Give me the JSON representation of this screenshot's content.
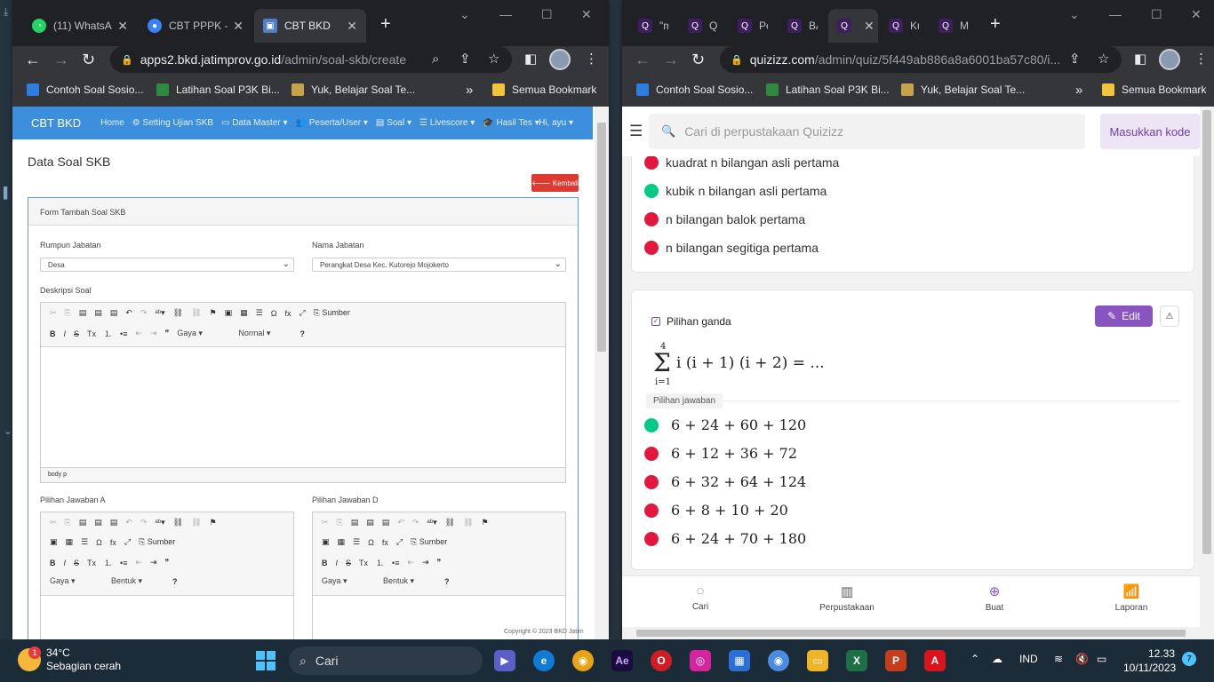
{
  "left_browser": {
    "tabs": [
      {
        "label": "(11) WhatsA",
        "icon": "whatsapp-icon",
        "color": "#25d366"
      },
      {
        "label": "CBT PPPK -",
        "icon": "user-icon",
        "color": "#3b82f6"
      },
      {
        "label": "CBT BKD",
        "icon": "jatim-logo-icon",
        "color": "#4f7ec4"
      }
    ],
    "url_host": "apps2.bkd.jatimprov.go.id",
    "url_path": "/admin/soal-skb/create",
    "bookmarks": [
      "Contoh Soal Sosio...",
      "Latihan Soal P3K Bi...",
      "Yuk, Belajar Soal Te..."
    ],
    "bookmarks_more": "»",
    "bookmarks_folder": "Semua Bookmark"
  },
  "cbt": {
    "brand": "CBT BKD",
    "menu": [
      "Home",
      "⚙ Setting Ujian SKB",
      "▭ Data Master ▾",
      "👥 Peserta/User ▾",
      "▤ Soal ▾",
      "☰ Livescore ▾",
      "🎓 Hasil Tes ▾"
    ],
    "user": "Hi, ayu ▾",
    "page_title": "Data Soal SKB",
    "back_button": "🡐 Kembali",
    "form_title": "Form Tambah Soal SKB",
    "rumpun_label": "Rumpun Jabatan",
    "rumpun_value": "Desa",
    "nama_label": "Nama Jabatan",
    "nama_value": "Perangkat Desa Kec. Kutorejo Mojokerto",
    "deskripsi_label": "Deskripsi Soal",
    "editor_source": "Sumber",
    "editor_style": "Gaya",
    "editor_format": "Normal",
    "editor_shape": "Bentuk",
    "editor_help": "?",
    "editor_path": "body   p",
    "pilihan_a_label": "Pilihan Jawaban A",
    "pilihan_d_label": "Pilihan Jawaban D",
    "copyright": "Copyright © 2023 BKD Jatim"
  },
  "right_browser": {
    "tabs": [
      "\"m",
      "Qu",
      "Per",
      "BA",
      "",
      "Kui",
      "MA"
    ],
    "url_host": "quizizz.com",
    "url_path": "/admin/quiz/5f449ab886a8a6001ba57c80/i...",
    "bookmarks": [
      "Contoh Soal Sosio...",
      "Latihan Soal P3K Bi...",
      "Yuk, Belajar Soal Te..."
    ],
    "bookmarks_more": "»",
    "bookmarks_folder": "Semua Bookmark"
  },
  "quizizz": {
    "search_placeholder": "Cari di perpustakaan Quizizz",
    "enter_code": "Masukkan kode",
    "prev_options": [
      {
        "text": "kuadrat n bilangan asli pertama",
        "correct": false
      },
      {
        "text": "kubik n bilangan asli pertama",
        "correct": true
      },
      {
        "text": "n bilangan balok pertama",
        "correct": false
      },
      {
        "text": "n bilangan segitiga pertama",
        "correct": false
      }
    ],
    "question_type": "Pilihan ganda",
    "edit_label": "Edit",
    "sum_upper": "4",
    "sum_lower": "i=1",
    "sum_expr": "i (i + 1) (i + 2) = ...",
    "answers_label": "Pilihan jawaban",
    "answers": [
      {
        "text": "6 + 24 + 60 + 120",
        "correct": true
      },
      {
        "text": "6 + 12 + 36 + 72",
        "correct": false
      },
      {
        "text": "6 + 32 + 64 + 124",
        "correct": false
      },
      {
        "text": "6 + 8 + 10 + 20",
        "correct": false
      },
      {
        "text": "6 + 24 + 70 + 180",
        "correct": false
      }
    ],
    "bottom_nav": [
      {
        "label": "Cari",
        "icon": "search-icon"
      },
      {
        "label": "Perpustakaan",
        "icon": "library-icon"
      },
      {
        "label": "Buat",
        "icon": "plus-circle-icon"
      },
      {
        "label": "Laporan",
        "icon": "chart-icon"
      }
    ]
  },
  "taskbar": {
    "temp": "34°C",
    "weather": "Sebagian cerah",
    "weather_badge": "1",
    "search": "Cari",
    "lang": "IND",
    "time": "12.33",
    "date": "10/11/2023",
    "notifications": "7"
  },
  "colors": {
    "cbt_nav": "#3c8fdc",
    "quizizz_purple": "#8854c0",
    "correct": "#00c985",
    "wrong": "#e2173d"
  }
}
